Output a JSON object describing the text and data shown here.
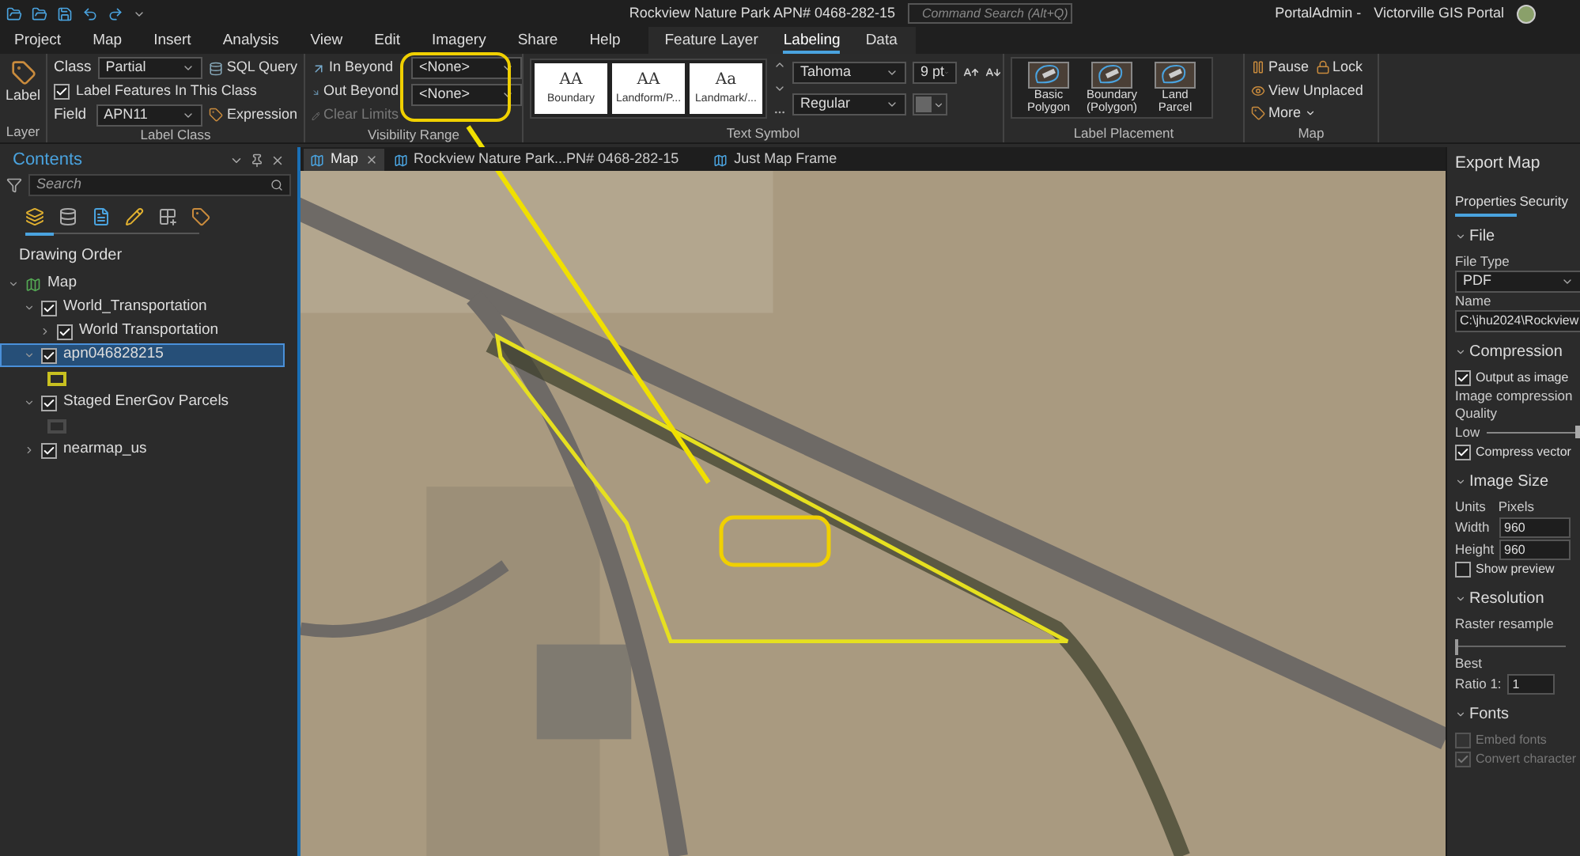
{
  "title_bar": {
    "title": "Rockview Nature Park APN# 0468-282-15",
    "search_placeholder": "Command Search (Alt+Q)",
    "user": "PortalAdmin -",
    "portal": "Victorville GIS Portal"
  },
  "menu_tabs": [
    {
      "label": "Project",
      "selected": false
    },
    {
      "label": "Map",
      "selected": false
    },
    {
      "label": "Insert",
      "selected": false
    },
    {
      "label": "Analysis",
      "selected": false
    },
    {
      "label": "View",
      "selected": false
    },
    {
      "label": "Edit",
      "selected": false
    },
    {
      "label": "Imagery",
      "selected": false
    },
    {
      "label": "Share",
      "selected": false
    },
    {
      "label": "Help",
      "selected": false
    }
  ],
  "contextual": {
    "group": "Feature Layer",
    "tabs": [
      {
        "label": "Labeling",
        "selected": true
      },
      {
        "label": "Data",
        "selected": false
      }
    ]
  },
  "ribbon": {
    "layer": {
      "button": "Label",
      "group": "Layer"
    },
    "label_class": {
      "class_label": "Class",
      "class_value": "Partial",
      "sql": "SQL Query",
      "label_features": {
        "label": "Label Features In This Class",
        "checked": true
      },
      "field_label": "Field",
      "field_value": "APN11",
      "expression": "Expression",
      "group": "Label Class"
    },
    "visibility": {
      "in_beyond": "In Beyond",
      "out_beyond": "Out Beyond",
      "in_value": "<None>",
      "out_value": "<None>",
      "clear": {
        "label": "Clear Limits",
        "disabled": true
      },
      "group": "Visibility Range"
    },
    "text_symbol": {
      "styles": [
        {
          "preview": "AA",
          "label": "Boundary"
        },
        {
          "preview": "AA",
          "label": "Landform/P..."
        },
        {
          "preview": "Aa",
          "label": "Landmark/..."
        }
      ],
      "font": "Tahoma",
      "size": "9 pt",
      "style": "Regular",
      "group": "Text Symbol"
    },
    "label_placement": {
      "items": [
        "Basic Polygon",
        "Boundary (Polygon)",
        "Land Parcel"
      ],
      "group": "Label Placement"
    },
    "map": {
      "pause": "Pause",
      "lock": "Lock",
      "view_unplaced": "View Unplaced",
      "more": "More",
      "group": "Map"
    }
  },
  "contents": {
    "title": "Contents",
    "search_placeholder": "Search",
    "heading": "Drawing Order",
    "tree": [
      {
        "label": "Map",
        "kind": "map",
        "expanded": true,
        "children": [
          {
            "label": "World_Transportation",
            "kind": "layer",
            "checked": true,
            "expanded": true,
            "selected": false,
            "children": [
              {
                "label": "World Transportation",
                "kind": "layer",
                "checked": true,
                "expanded": false,
                "selected": false
              }
            ]
          },
          {
            "label": "apn046828215",
            "kind": "layer",
            "checked": true,
            "expanded": true,
            "selected": true,
            "symbol": {
              "color": "#c8c020"
            }
          },
          {
            "label": "Staged EnerGov Parcels",
            "kind": "layer",
            "checked": true,
            "expanded": true,
            "selected": false,
            "symbol": {
              "color": "#4a4a4a"
            }
          },
          {
            "label": "nearmap_us",
            "kind": "layer",
            "checked": true,
            "expanded": false,
            "selected": false
          }
        ]
      }
    ]
  },
  "map_tabs": [
    {
      "label": "Map",
      "selected": true
    },
    {
      "label": "Rockview Nature Park...PN# 0468-282-15",
      "selected": false
    },
    {
      "label": "Just Map Frame",
      "selected": false
    }
  ],
  "export": {
    "title": "Export Map",
    "tabs": [
      {
        "label": "Properties",
        "selected": true
      },
      {
        "label": "Security",
        "selected": false
      }
    ],
    "file": {
      "heading": "File",
      "type_label": "File Type",
      "type_value": "PDF",
      "name_label": "Name",
      "name_value": "C:\\jhu2024\\Rockview"
    },
    "compression": {
      "heading": "Compression",
      "output_as_image": {
        "label": "Output as image",
        "checked": true
      },
      "image_compression": "Image compression",
      "quality": "Quality",
      "quality_slider": {
        "value_label": "Low",
        "level": 1
      },
      "compress_vector": {
        "label": "Compress vector",
        "checked": true
      }
    },
    "image_size": {
      "heading": "Image Size",
      "units_label": "Units",
      "units_value": "Pixels",
      "width_label": "Width",
      "width_value": "960",
      "height_label": "Height",
      "height_value": "960",
      "show_preview": {
        "label": "Show preview",
        "checked": false
      }
    },
    "resolution": {
      "heading": "Resolution",
      "raster_resample": "Raster resample",
      "resample_slider": {
        "level": 0
      },
      "best": "Best",
      "ratio_label": "Ratio 1:",
      "ratio_value": "1"
    },
    "fonts": {
      "heading": "Fonts",
      "embed": {
        "label": "Embed fonts",
        "checked": false,
        "disabled": true
      },
      "convert": {
        "label": "Convert character",
        "checked": true,
        "disabled": true
      }
    }
  }
}
